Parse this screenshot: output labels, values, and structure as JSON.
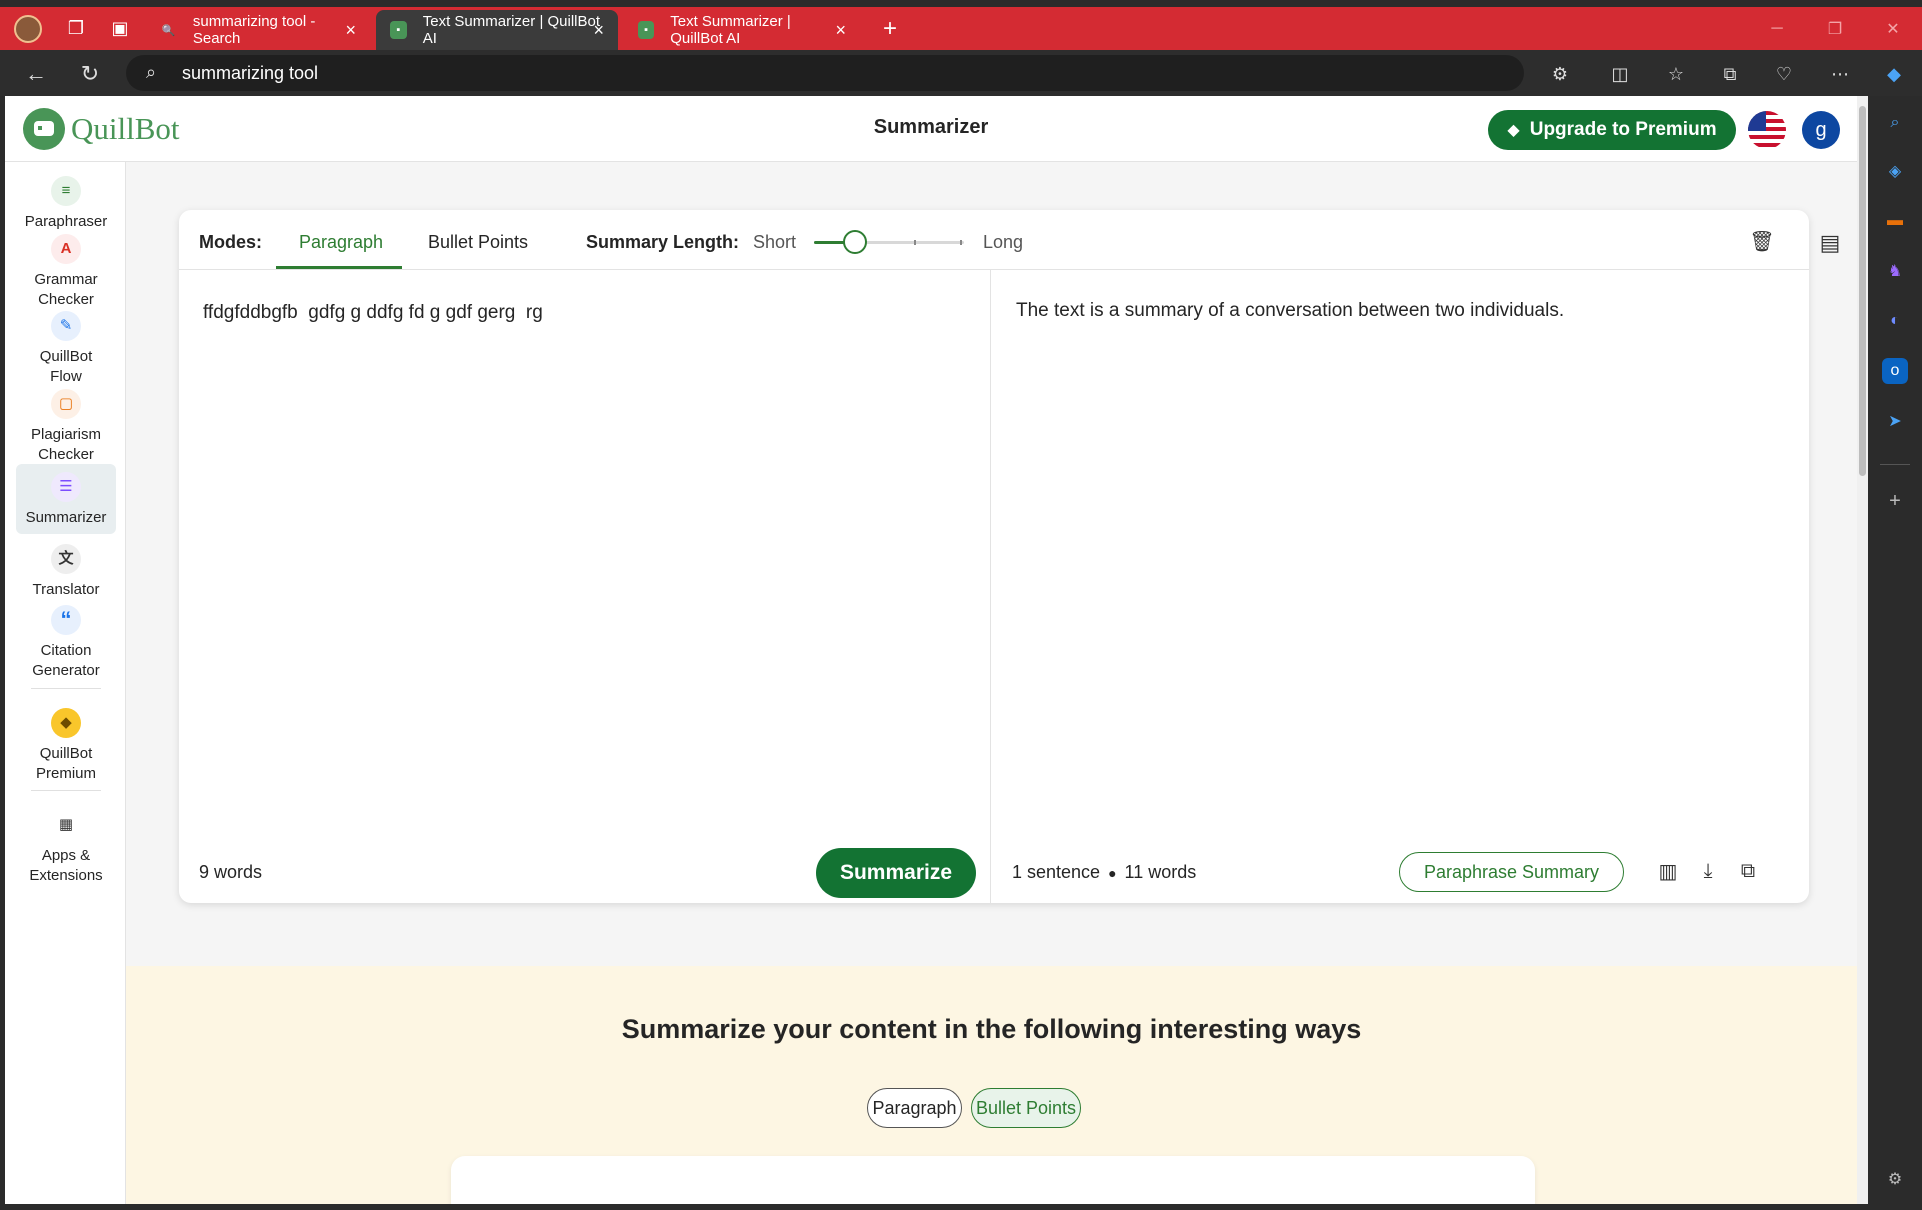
{
  "browser": {
    "tabs": [
      {
        "title": "summarizing tool - Search",
        "favicon": "search-icon"
      },
      {
        "title": "Text Summarizer | QuillBot AI",
        "favicon": "quillbot-icon"
      },
      {
        "title": "Text Summarizer | QuillBot AI",
        "favicon": "quillbot-icon"
      }
    ],
    "address": "summarizing tool"
  },
  "app": {
    "logo_text": "QuillBot",
    "page_title": "Summarizer",
    "upgrade_label": "Upgrade to Premium",
    "user_initial": "g",
    "accent": "#137333"
  },
  "sidebar": {
    "items": [
      {
        "label": "Paraphraser",
        "icon": "paraphraser-icon"
      },
      {
        "label": "Grammar Checker",
        "icon": "grammar-icon"
      },
      {
        "label": "QuillBot Flow",
        "icon": "flow-icon"
      },
      {
        "label": "Plagiarism Checker",
        "icon": "plagiarism-icon"
      },
      {
        "label": "Summarizer",
        "icon": "summarizer-icon",
        "active": true
      },
      {
        "label": "Translator",
        "icon": "translator-icon"
      },
      {
        "label": "Citation Generator",
        "icon": "citation-icon"
      },
      {
        "label": "QuillBot Premium",
        "icon": "premium-icon"
      },
      {
        "label": "Apps & Extensions",
        "icon": "apps-icon"
      }
    ]
  },
  "summarizer": {
    "modes_label": "Modes:",
    "modes": [
      "Paragraph",
      "Bullet Points"
    ],
    "active_mode": "Paragraph",
    "length_label": "Summary Length:",
    "length_min": "Short",
    "length_max": "Long",
    "length_value": 0.27,
    "input_text": "ffdgfddbgfb  gdfg g ddfg fd g gdf gerg  rg",
    "input_word_count": "9 words",
    "summarize_label": "Summarize",
    "output_text": "The text is a summary of a conversation between two individuals.",
    "output_sentences": "1 sentence",
    "output_words": "11 words",
    "paraphrase_summary_label": "Paraphrase Summary"
  },
  "promo": {
    "title": "Summarize your content in the following interesting ways",
    "chips": [
      "Paragraph",
      "Bullet Points"
    ],
    "selected_chip": "Bullet Points"
  }
}
